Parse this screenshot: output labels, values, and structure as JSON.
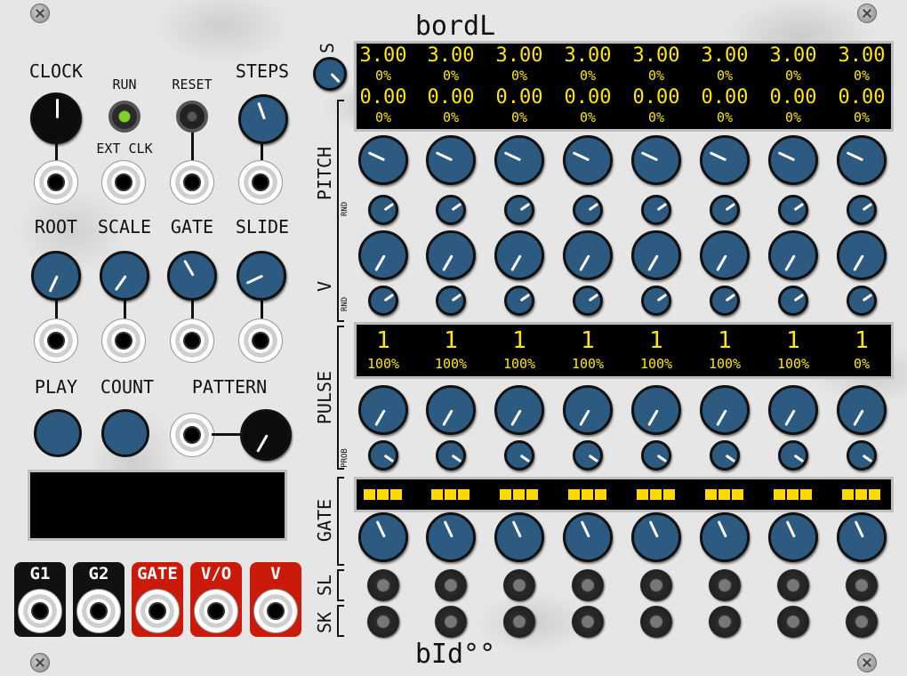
{
  "module": {
    "title": "bordL",
    "brand": "bId°°"
  },
  "left": {
    "clock": "CLOCK",
    "run": "RUN",
    "reset": "RESET",
    "steps": "STEPS",
    "ext_clk": "EXT CLK",
    "root": "ROOT",
    "scale": "SCALE",
    "gate": "GATE",
    "slide": "SLIDE",
    "play": "PLAY",
    "count": "COUNT",
    "pattern": "PATTERN"
  },
  "outputs": [
    {
      "label": "G1",
      "color": "#111111"
    },
    {
      "label": "G2",
      "color": "#111111"
    },
    {
      "label": "GATE",
      "color": "#cc1a0a"
    },
    {
      "label": "V/O",
      "color": "#cc1a0a"
    },
    {
      "label": "V",
      "color": "#cc1a0a"
    }
  ],
  "rows": {
    "s": "S",
    "pitch": "PITCH",
    "rnd1": "RND",
    "v": "V",
    "rnd2": "RND",
    "pulse": "PULSE",
    "prob": "PROB",
    "gate": "GATE",
    "sl": "SL",
    "sk": "SK"
  },
  "display_top": {
    "row1_values": [
      "3.00",
      "3.00",
      "3.00",
      "3.00",
      "3.00",
      "3.00",
      "3.00",
      "3.00"
    ],
    "row1_pct": [
      "0%",
      "0%",
      "0%",
      "0%",
      "0%",
      "0%",
      "0%",
      "0%"
    ],
    "row2_values": [
      "0.00",
      "0.00",
      "0.00",
      "0.00",
      "0.00",
      "0.00",
      "0.00",
      "0.00"
    ],
    "row2_pct": [
      "0%",
      "0%",
      "0%",
      "0%",
      "0%",
      "0%",
      "0%",
      "0%"
    ]
  },
  "display_pulse": {
    "counts": [
      "1",
      "1",
      "1",
      "1",
      "1",
      "1",
      "1",
      "1"
    ],
    "probs": [
      "100%",
      "100%",
      "100%",
      "100%",
      "100%",
      "100%",
      "100%",
      "0%"
    ]
  },
  "colors": {
    "knob": "#2d5a80",
    "display_text": "#ffe800",
    "led_run": "#7fd02a"
  }
}
